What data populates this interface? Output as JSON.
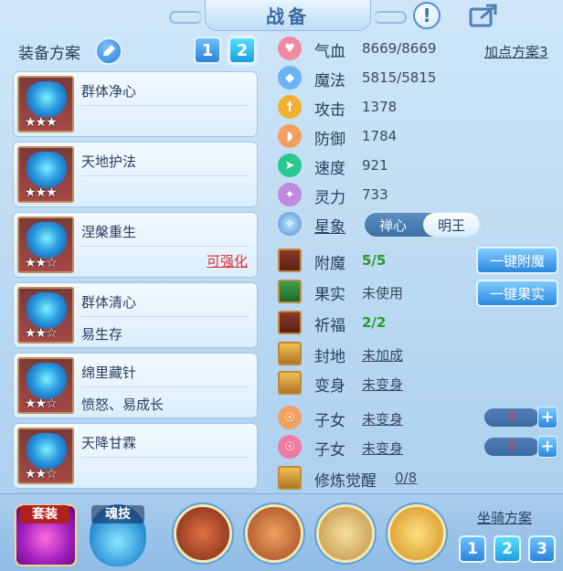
{
  "header": {
    "title": "战备"
  },
  "icons": {
    "info": "info-icon",
    "share": "share-icon",
    "edit": "edit-icon"
  },
  "equipment": {
    "label": "装备方案",
    "pages": [
      "1",
      "2"
    ],
    "active_page": "2",
    "cards": [
      {
        "name": "群体净心",
        "sub": "",
        "action": "",
        "stars": "★★★"
      },
      {
        "name": "天地护法",
        "sub": "",
        "action": "",
        "stars": "★★★"
      },
      {
        "name": "涅槃重生",
        "sub": "",
        "action": "可强化",
        "stars": "★★☆"
      },
      {
        "name": "群体清心",
        "sub": "易生存",
        "action": "",
        "stars": "★★☆"
      },
      {
        "name": "绵里藏针",
        "sub": "愤怒、易成长",
        "action": "",
        "stars": "★★☆"
      },
      {
        "name": "天降甘霖",
        "sub": "",
        "action": "",
        "stars": "★★☆"
      }
    ]
  },
  "stats": {
    "plan_link": "加点方案3",
    "rows": [
      {
        "label": "气血",
        "value": "8669/8669",
        "icon": "heart-icon",
        "color": "#f08aa0"
      },
      {
        "label": "魔法",
        "value": "5815/5815",
        "icon": "magic-icon",
        "color": "#6ab4f5"
      },
      {
        "label": "攻击",
        "value": "1378",
        "icon": "sword-icon",
        "color": "#f2b030"
      },
      {
        "label": "防御",
        "value": "1784",
        "icon": "shield-icon",
        "color": "#f2a060"
      },
      {
        "label": "速度",
        "value": "921",
        "icon": "speed-icon",
        "color": "#2ac890"
      },
      {
        "label": "灵力",
        "value": "733",
        "icon": "spirit-icon",
        "color": "#c08ae0"
      }
    ]
  },
  "xingxiang": {
    "label": "星象",
    "options": [
      "禅心",
      "明王"
    ],
    "selected": "明王"
  },
  "enhance": {
    "rows": [
      {
        "label": "附魔",
        "value": "5/5",
        "icon": "enchant-icon"
      },
      {
        "label": "果实",
        "value": "未使用",
        "icon": "fruit-icon"
      },
      {
        "label": "祈福",
        "value": "2/2",
        "icon": "blessing-icon"
      },
      {
        "label": "封地",
        "value": "未加成",
        "icon": "fief-icon"
      },
      {
        "label": "变身",
        "value": "未变身",
        "icon": "transform-icon"
      },
      {
        "label": "子女",
        "value": "未变身",
        "icon": "child-icon"
      },
      {
        "label": "子女",
        "value": "未变身",
        "icon": "child-icon"
      },
      {
        "label": "修炼觉醒",
        "value": "0/8",
        "icon": "cultivation-icon"
      }
    ],
    "buttons": {
      "enchant": "一键附魔",
      "fruit": "一键果实"
    },
    "steppers": [
      "0",
      "0"
    ],
    "plus": "+"
  },
  "bottom": {
    "suit_label": "套装",
    "soul_label": "魂技",
    "mounts": [
      "mount-1",
      "mount-2",
      "mount-3",
      "mount-4",
      "mount-5"
    ],
    "mount_plan_label": "坐骑方案",
    "mount_pages": [
      "1",
      "2",
      "3"
    ],
    "mount_active": "2"
  }
}
